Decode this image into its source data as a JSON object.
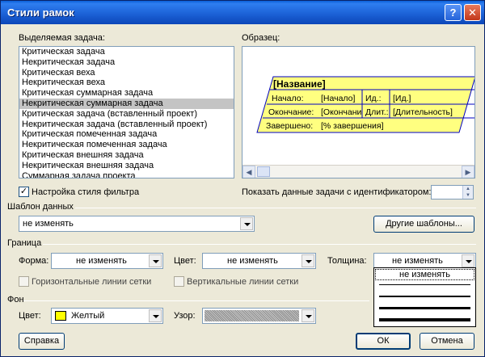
{
  "window": {
    "title": "Стили рамок",
    "help_icon": "?",
    "close_icon": "✕"
  },
  "task_list": {
    "label": "Выделяемая задача:",
    "items": [
      "Критическая задача",
      "Некритическая задача",
      "Критическая веха",
      "Некритическая веха",
      "Критическая суммарная задача",
      "Некритическая суммарная задача",
      "Критическая задача (вставленный проект)",
      "Некритическая задача (вставленный проект)",
      "Критическая помеченная задача",
      "Некритическая помеченная задача",
      "Критическая внешняя задача",
      "Некритическая внешняя задача",
      "Суммарная задача проекта"
    ],
    "selected": "Некритическая суммарная задача"
  },
  "sample": {
    "label": "Образец:",
    "name": "[Название]",
    "start_label": "Начало:",
    "start_value": "[Начало]",
    "id_label": "Ид.:",
    "id_value": "[Ид.]",
    "finish_label": "Окончание:",
    "finish_value": "[Окончание]",
    "duration_label": "Длит.:",
    "duration_value": "[Длительность]",
    "complete_label": "Завершено:",
    "complete_value": "[% завершения]",
    "fill_color": "#ffff80",
    "border_color": "#0000c0"
  },
  "filter_style": {
    "label": "Настройка стиля фильтра",
    "checked": true
  },
  "show_task_id": {
    "label": "Показать данные задачи с идентификатором:",
    "value": ""
  },
  "data_template": {
    "label": "Шаблон данных",
    "value": "не изменять",
    "other_button": "Другие шаблоны..."
  },
  "border": {
    "label": "Граница",
    "shape_label": "Форма:",
    "shape_value": "не изменять",
    "color_label": "Цвет:",
    "color_value": "не изменять",
    "width_label": "Толщина:",
    "width_value": "не изменять",
    "width_options": [
      "не изменять"
    ],
    "hgrid_label": "Горизонтальные линии сетки",
    "vgrid_label": "Вертикальные линии сетки"
  },
  "background": {
    "label": "Фон",
    "color_label": "Цвет:",
    "color_value": "Желтый",
    "color_swatch": "#ffff00",
    "pattern_label": "Узор:"
  },
  "buttons": {
    "help": "Справка",
    "ok": "ОК",
    "cancel": "Отмена"
  }
}
